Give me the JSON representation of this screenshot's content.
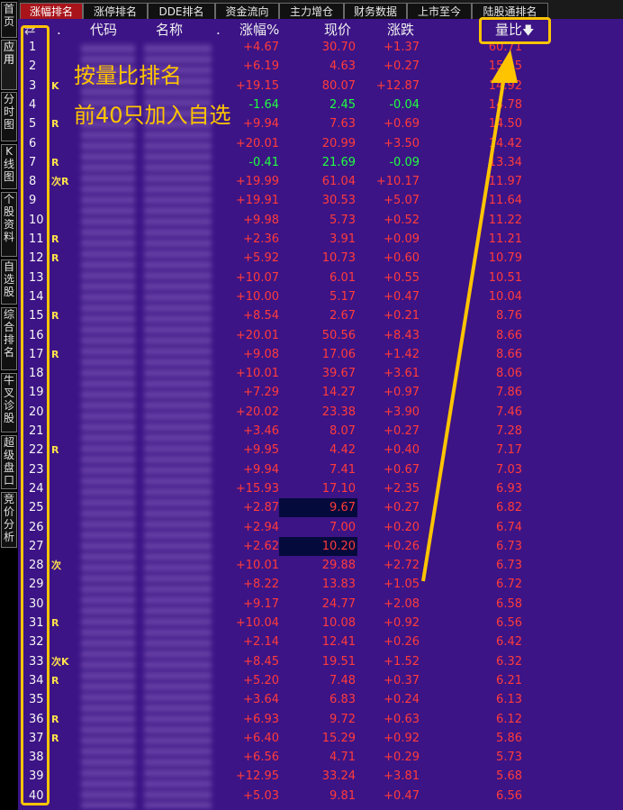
{
  "tabs": [
    "涨幅排名",
    "涨停排名",
    "DDE排名",
    "资金流向",
    "主力增仓",
    "财务数据",
    "上市至今",
    "陆股通排名"
  ],
  "sidebar": [
    "首页",
    "应用",
    "分时图",
    "K线图",
    "个股资料",
    "自选股",
    "综合排名",
    "牛叉诊股",
    "超级盘口",
    "竞价分析"
  ],
  "headers": {
    "dot1": ".",
    "code": "代码",
    "name": "名称",
    "dot2": ".",
    "change_pct": "涨幅%",
    "price": "现价",
    "change": "涨跌",
    "volume_ratio": "量比"
  },
  "annotation": [
    "按量比排名",
    "前40只加入自选"
  ],
  "colors": {
    "background": "#3c1486",
    "up": "#ff3b3b",
    "down": "#20ff40",
    "highlight": "#ffc400"
  },
  "rows": [
    {
      "idx": "1",
      "flag": "",
      "pct": "+4.67",
      "price": "30.70",
      "chg": "+1.37",
      "vr": "60.71"
    },
    {
      "idx": "2",
      "flag": "",
      "pct": "+6.19",
      "price": "4.63",
      "chg": "+0.27",
      "vr": "15.15"
    },
    {
      "idx": "3",
      "flag": "K",
      "pct": "+19.15",
      "price": "80.07",
      "chg": "+12.87",
      "vr": "14.92"
    },
    {
      "idx": "4",
      "flag": "",
      "pct": "-1.64",
      "price": "2.45",
      "chg": "-0.04",
      "vr": "14.78"
    },
    {
      "idx": "5",
      "flag": "R",
      "pct": "+9.94",
      "price": "7.63",
      "chg": "+0.69",
      "vr": "14.50"
    },
    {
      "idx": "6",
      "flag": "",
      "pct": "+20.01",
      "price": "20.99",
      "chg": "+3.50",
      "vr": "14.42"
    },
    {
      "idx": "7",
      "flag": "R",
      "pct": "-0.41",
      "price": "21.69",
      "chg": "-0.09",
      "vr": "13.34"
    },
    {
      "idx": "8",
      "flag": "次R",
      "pct": "+19.99",
      "price": "61.04",
      "chg": "+10.17",
      "vr": "11.97"
    },
    {
      "idx": "9",
      "flag": "",
      "pct": "+19.91",
      "price": "30.53",
      "chg": "+5.07",
      "vr": "11.64"
    },
    {
      "idx": "10",
      "flag": "",
      "pct": "+9.98",
      "price": "5.73",
      "chg": "+0.52",
      "vr": "11.22"
    },
    {
      "idx": "11",
      "flag": "R",
      "pct": "+2.36",
      "price": "3.91",
      "chg": "+0.09",
      "vr": "11.21"
    },
    {
      "idx": "12",
      "flag": "R",
      "pct": "+5.92",
      "price": "10.73",
      "chg": "+0.60",
      "vr": "10.79"
    },
    {
      "idx": "13",
      "flag": "",
      "pct": "+10.07",
      "price": "6.01",
      "chg": "+0.55",
      "vr": "10.51"
    },
    {
      "idx": "14",
      "flag": "",
      "pct": "+10.00",
      "price": "5.17",
      "chg": "+0.47",
      "vr": "10.04"
    },
    {
      "idx": "15",
      "flag": "R",
      "pct": "+8.54",
      "price": "2.67",
      "chg": "+0.21",
      "vr": "8.76"
    },
    {
      "idx": "16",
      "flag": "",
      "pct": "+20.01",
      "price": "50.56",
      "chg": "+8.43",
      "vr": "8.66"
    },
    {
      "idx": "17",
      "flag": "R",
      "pct": "+9.08",
      "price": "17.06",
      "chg": "+1.42",
      "vr": "8.66"
    },
    {
      "idx": "18",
      "flag": "",
      "pct": "+10.01",
      "price": "39.67",
      "chg": "+3.61",
      "vr": "8.06"
    },
    {
      "idx": "19",
      "flag": "",
      "pct": "+7.29",
      "price": "14.27",
      "chg": "+0.97",
      "vr": "7.86"
    },
    {
      "idx": "20",
      "flag": "",
      "pct": "+20.02",
      "price": "23.38",
      "chg": "+3.90",
      "vr": "7.46"
    },
    {
      "idx": "21",
      "flag": "",
      "pct": "+3.46",
      "price": "8.07",
      "chg": "+0.27",
      "vr": "7.28"
    },
    {
      "idx": "22",
      "flag": "R",
      "pct": "+9.95",
      "price": "4.42",
      "chg": "+0.40",
      "vr": "7.17"
    },
    {
      "idx": "23",
      "flag": "",
      "pct": "+9.94",
      "price": "7.41",
      "chg": "+0.67",
      "vr": "7.03"
    },
    {
      "idx": "24",
      "flag": "",
      "pct": "+15.93",
      "price": "17.10",
      "chg": "+2.35",
      "vr": "6.93"
    },
    {
      "idx": "25",
      "flag": "",
      "pct": "+2.87",
      "price": "9.67",
      "chg": "+0.27",
      "vr": "6.82",
      "hl": true
    },
    {
      "idx": "26",
      "flag": "",
      "pct": "+2.94",
      "price": "7.00",
      "chg": "+0.20",
      "vr": "6.74"
    },
    {
      "idx": "27",
      "flag": "",
      "pct": "+2.62",
      "price": "10.20",
      "chg": "+0.26",
      "vr": "6.73",
      "hl": true
    },
    {
      "idx": "28",
      "flag": "次",
      "pct": "+10.01",
      "price": "29.88",
      "chg": "+2.72",
      "vr": "6.73"
    },
    {
      "idx": "29",
      "flag": "",
      "pct": "+8.22",
      "price": "13.83",
      "chg": "+1.05",
      "vr": "6.72"
    },
    {
      "idx": "30",
      "flag": "",
      "pct": "+9.17",
      "price": "24.77",
      "chg": "+2.08",
      "vr": "6.58"
    },
    {
      "idx": "31",
      "flag": "R",
      "pct": "+10.04",
      "price": "10.08",
      "chg": "+0.92",
      "vr": "6.56"
    },
    {
      "idx": "32",
      "flag": "",
      "pct": "+2.14",
      "price": "12.41",
      "chg": "+0.26",
      "vr": "6.42"
    },
    {
      "idx": "33",
      "flag": "次K",
      "pct": "+8.45",
      "price": "19.51",
      "chg": "+1.52",
      "vr": "6.32"
    },
    {
      "idx": "34",
      "flag": "R",
      "pct": "+5.20",
      "price": "7.48",
      "chg": "+0.37",
      "vr": "6.21"
    },
    {
      "idx": "35",
      "flag": "",
      "pct": "+3.64",
      "price": "6.83",
      "chg": "+0.24",
      "vr": "6.13"
    },
    {
      "idx": "36",
      "flag": "R",
      "pct": "+6.93",
      "price": "9.72",
      "chg": "+0.63",
      "vr": "6.12"
    },
    {
      "idx": "37",
      "flag": "R",
      "pct": "+6.40",
      "price": "15.29",
      "chg": "+0.92",
      "vr": "5.86"
    },
    {
      "idx": "38",
      "flag": "",
      "pct": "+6.56",
      "price": "4.71",
      "chg": "+0.29",
      "vr": "5.73"
    },
    {
      "idx": "39",
      "flag": "",
      "pct": "+12.95",
      "price": "33.24",
      "chg": "+3.81",
      "vr": "5.68"
    },
    {
      "idx": "40",
      "flag": "",
      "pct": "+5.03",
      "price": "9.81",
      "chg": "+0.47",
      "vr": "6.56"
    }
  ]
}
